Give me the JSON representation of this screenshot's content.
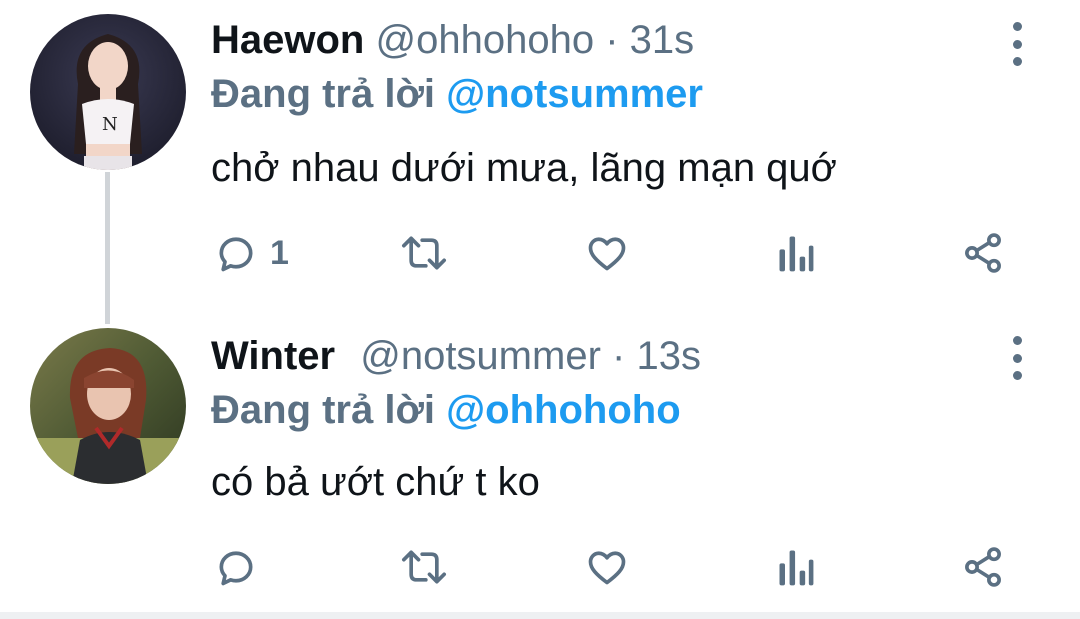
{
  "tweets": [
    {
      "name": "Haewon",
      "handle": "@ohhohoho",
      "separator": "·",
      "time": "31s",
      "reply_prefix": "Đang trả lời",
      "reply_mention": "@notsummer",
      "text": "chở nhau dưới mưa, lãng mạn quớ",
      "reply_count": "1",
      "avatar_icon": "user-avatar-photo"
    },
    {
      "name": "Winter",
      "handle": "@notsummer",
      "separator": "·",
      "time": "13s",
      "reply_prefix": "Đang trả lời",
      "reply_mention": "@ohhohoho",
      "text": "có bả ướt chứ t ko",
      "reply_count": "",
      "avatar_icon": "user-avatar-photo"
    }
  ],
  "colors": {
    "mention": "#1d9bf0",
    "secondary_text": "#5b7083",
    "primary_text": "#0f1419",
    "thread_line": "#d0d4d8"
  },
  "icons": [
    "reply-icon",
    "retweet-icon",
    "like-icon",
    "analytics-icon",
    "share-icon",
    "more-options-icon"
  ]
}
